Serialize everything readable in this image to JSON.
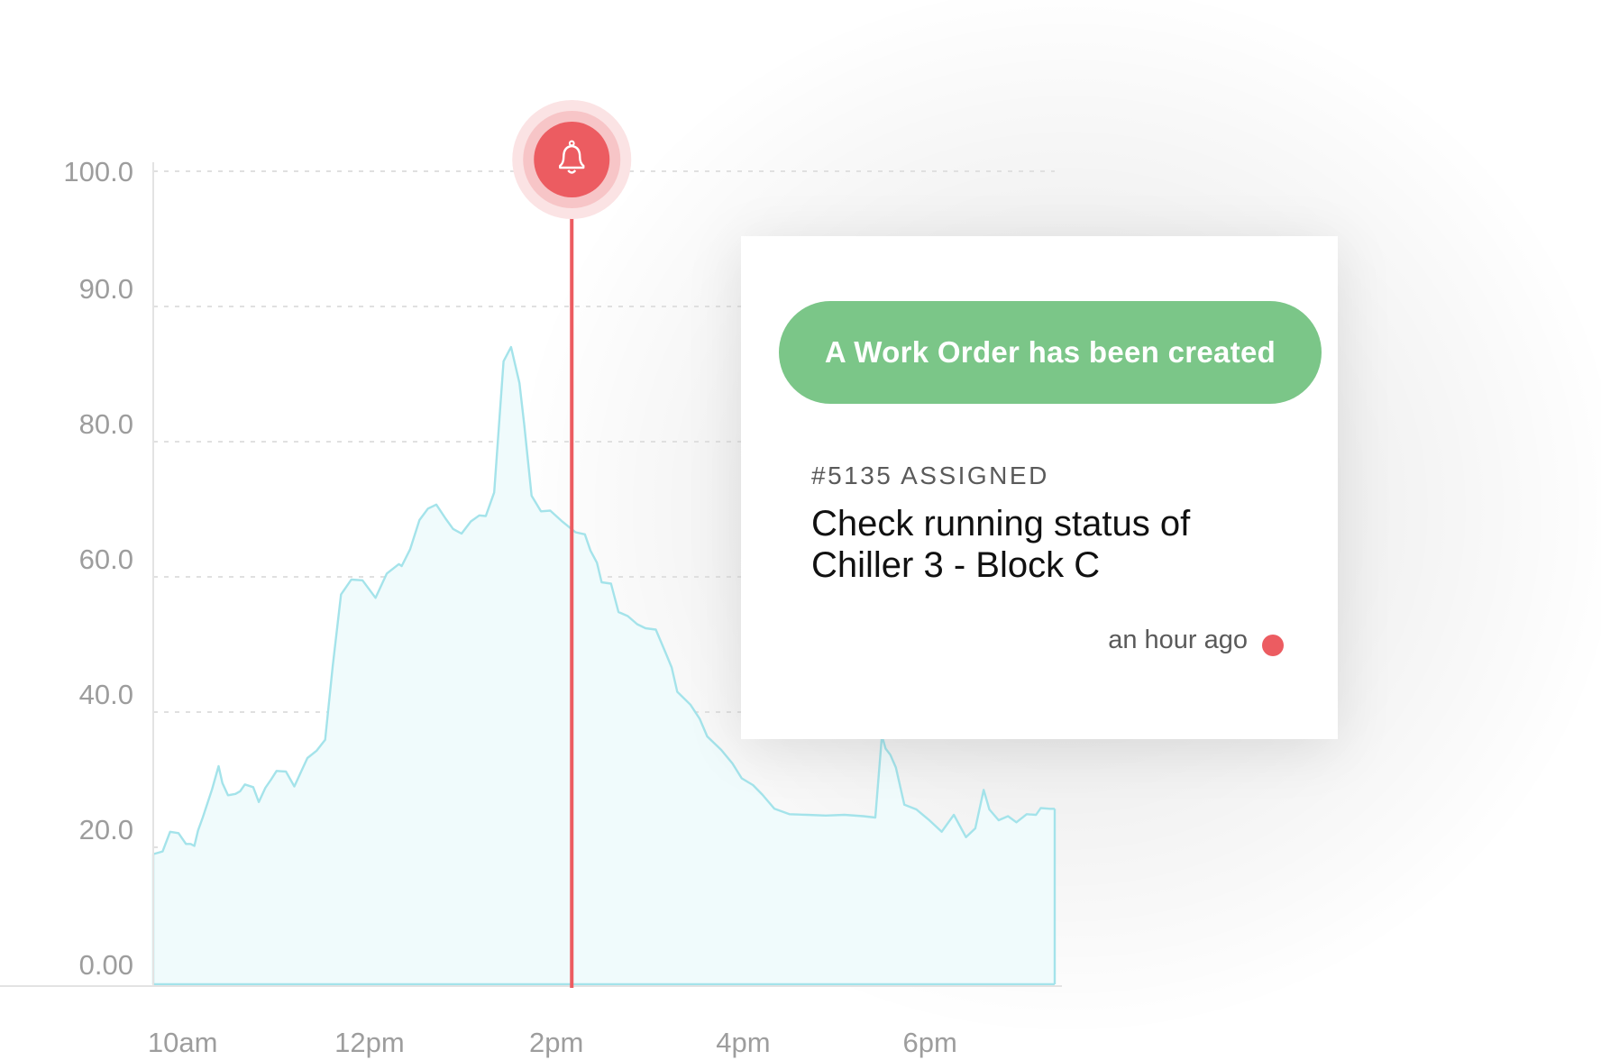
{
  "chart_data": {
    "type": "area",
    "yticks": [
      "100.0",
      "90.0",
      "80.0",
      "60.0",
      "40.0",
      "20.0",
      "0.00"
    ],
    "ytick_values": [
      100,
      90,
      80,
      60,
      40,
      20,
      0
    ],
    "xticks": [
      "10am",
      "12pm",
      "2pm",
      "4pm",
      "6pm"
    ],
    "xtick_values": [
      10,
      12,
      14,
      16,
      18
    ],
    "x_range": [
      9.55,
      19.2
    ],
    "grid": true,
    "series": [
      {
        "x": [
          9.55,
          9.65,
          9.73,
          9.82,
          9.9,
          9.95,
          9.99,
          10.03,
          10.08,
          10.18,
          10.25,
          10.29,
          10.35,
          10.43,
          10.48,
          10.53,
          10.62,
          10.68,
          10.75,
          10.81,
          10.87,
          10.97,
          11.06,
          11.12,
          11.2,
          11.3,
          11.39,
          11.47,
          11.56,
          11.67,
          11.79,
          11.93,
          12.05,
          12.18,
          12.21,
          12.3,
          12.4,
          12.49,
          12.58,
          12.68,
          12.76,
          12.85,
          12.95,
          13.04,
          13.11,
          13.2,
          13.3,
          13.38,
          13.47,
          13.52,
          13.6,
          13.7,
          13.8,
          13.92,
          14.07,
          14.17,
          14.23,
          14.3,
          14.35,
          14.45,
          14.53,
          14.63,
          14.73,
          14.82,
          14.93,
          15.04,
          15.1,
          15.16,
          15.3,
          15.4,
          15.48,
          15.63,
          15.75,
          15.85,
          15.97,
          16.07,
          16.2,
          16.36,
          16.55,
          16.75,
          16.95,
          17.15,
          17.28,
          17.35,
          17.39,
          17.44,
          17.5,
          17.59,
          17.72,
          17.85,
          17.99,
          18.12,
          18.25,
          18.35,
          18.44,
          18.5,
          18.6,
          18.7,
          18.79,
          18.9,
          19.0,
          19.05,
          19.15,
          19.2
        ],
        "y": [
          19,
          19.4,
          22.3,
          22.1,
          20.5,
          20.5,
          20.2,
          22.5,
          24.4,
          28.6,
          32,
          29.5,
          27.7,
          27.9,
          28.3,
          29.3,
          28.9,
          26.7,
          28.8,
          30,
          31.3,
          31.2,
          29,
          30.8,
          33.2,
          34.3,
          35.9,
          46.7,
          57.4,
          59.6,
          59.5,
          56.9,
          60.5,
          61.9,
          61.6,
          64.1,
          68.4,
          70.1,
          70.7,
          68.6,
          67.1,
          66.4,
          68.2,
          69.1,
          69,
          72.5,
          91.9,
          94,
          88.7,
          82.7,
          72,
          69.7,
          69.8,
          68.3,
          66.6,
          66.3,
          63.9,
          62.1,
          59.2,
          59,
          54.8,
          54.2,
          53,
          52.4,
          52.2,
          48.6,
          46.6,
          43,
          41.1,
          39,
          36.4,
          34.4,
          32.4,
          30.2,
          29.2,
          27.8,
          25.7,
          24.9,
          24.8,
          24.7,
          24.8,
          24.6,
          24.4,
          36.5,
          34.6,
          33.7,
          31.8,
          26.3,
          25.6,
          24.1,
          22.3,
          24.8,
          21.5,
          22.8,
          28.5,
          25.6,
          24,
          24.6,
          23.7,
          24.9,
          24.8,
          25.8,
          25.7,
          25.7
        ]
      }
    ],
    "alert": {
      "x": 14.03
    }
  },
  "notification": {
    "banner": "A Work Order has been created",
    "id_line": "#5135 ASSIGNED",
    "title": "Check running status of Chiller 3 - Block C",
    "time": "an hour ago"
  },
  "colors": {
    "line": "#a4e3ea",
    "area": "#f0fbfc",
    "alert": "#ec5c61",
    "banner": "#7bc688",
    "grid": "#e0e0e0"
  },
  "icons": {
    "alert": "bell-icon"
  }
}
